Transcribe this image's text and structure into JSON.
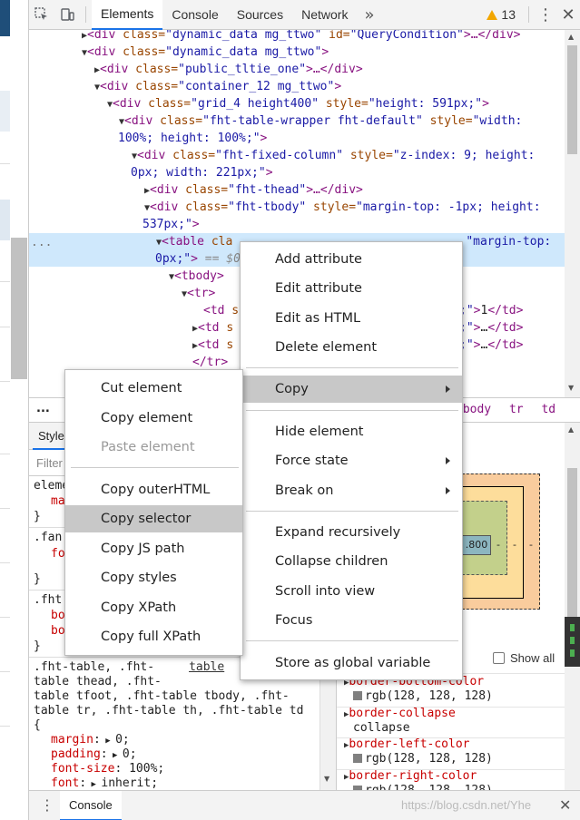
{
  "toolbar": {
    "tabs": [
      "Elements",
      "Console",
      "Sources",
      "Network"
    ],
    "more": "»",
    "warning_count": "13"
  },
  "tree": {
    "rows": [
      {
        "pre": "▶<",
        "tag": "div",
        "a1": " class=",
        "v1": "\"dynamic_data mg_ttwo\"",
        "a2": " id=",
        "v2": "\"QueryCondition\"",
        "post": ">…</div>"
      },
      {
        "pre": "▼<",
        "tag": "div",
        "a1": " class=",
        "v1": "\"dynamic_data mg_ttwo\"",
        "post": ">"
      },
      {
        "pre": "▶<",
        "tag": "div",
        "a1": " class=",
        "v1": "\"public_tltie_one\"",
        "post": ">…</div>"
      },
      {
        "pre": "▼<",
        "tag": "div",
        "a1": " class=",
        "v1": "\"container_12 mg_ttwo\"",
        "post": ">"
      },
      {
        "pre": "▼<",
        "tag": "div",
        "a1": " class=",
        "v1": "\"grid_4 height400\"",
        "a2": " style=",
        "v2": "\"height: 591px;\"",
        "post": ">"
      },
      {
        "pre": "▼<",
        "tag": "div",
        "a1": " class=",
        "v1": "\"fht-table-wrapper fht-default\"",
        "a2": " style=",
        "v2": "\"width:",
        "post": ""
      },
      {
        "pre": "",
        "tag": "",
        "v1": "100%; height: 100%;\"",
        "post": ">"
      },
      {
        "pre": "▼<",
        "tag": "div",
        "a1": " class=",
        "v1": "\"fht-fixed-column\"",
        "a2": " style=",
        "v2": "\"z-index: 9; height:",
        "post": ""
      },
      {
        "pre": "",
        "tag": "",
        "v1": "0px; width: 221px;\"",
        "post": ">"
      },
      {
        "pre": "▶<",
        "tag": "div",
        "a1": " class=",
        "v1": "\"fht-thead\"",
        "post": ">…</div>"
      },
      {
        "pre": "▼<",
        "tag": "div",
        "a1": " class=",
        "v1": "\"fht-tbody\"",
        "a2": " style=",
        "v2": "\"margin-top: -1px; height:",
        "post": ""
      },
      {
        "pre": "",
        "tag": "",
        "v1": "537px;\"",
        "post": ">"
      },
      {
        "pre": "▼<",
        "tag": "table",
        "a1": " cla",
        "v1": "",
        "a2": "",
        "v2": "\"margin-top:",
        "post": ""
      },
      {
        "pre": "",
        "tag": "",
        "v1": "0px;\"",
        "post": ">",
        "extra": " == $0"
      },
      {
        "pre": "▼<",
        "tag": "tbody",
        "post": ">"
      },
      {
        "pre": "▼<",
        "tag": "tr",
        "post": ">"
      },
      {
        "pre": "<",
        "tag": "td",
        "a1": " s",
        "post": "",
        "tail": ";\">1</td>"
      },
      {
        "pre": "▶<",
        "tag": "td",
        "a1": " s",
        "post": "",
        "tail": ";\">…</td>"
      },
      {
        "pre": "▶<",
        "tag": "td",
        "a1": " s",
        "post": "",
        "tail": ";\">…</td>"
      },
      {
        "pre": "</",
        "tag": "tr",
        "post": ">"
      }
    ],
    "gutter_dots": "..."
  },
  "crumbs": {
    "dots": "...",
    "items": [
      "tbody",
      "tr",
      "td"
    ]
  },
  "styles": {
    "tab": "Styles",
    "filter_placeholder": "Filter",
    "lines": {
      "l1": "eleme",
      "l2": "ma",
      "l3": "}",
      "l4": ".fan",
      "l5": "fo",
      "l6": "}",
      "l7": ".fht",
      "l8": "bo",
      "l9": "bo",
      "l10": "}",
      "r1a": ".fht-table, .fht-",
      "r1link": "table",
      "r2": "table thead, .fht-",
      "r3": "table tfoot, .fht-table tbody, .fht-",
      "r4": "table tr, .fht-table th, .fht-table td",
      "r5": "{",
      "p1": "margin",
      "p1v": "0;",
      "p2": "padding",
      "p2v": "0;",
      "p3": "font-size",
      "p3v": "100%;",
      "p4": "font",
      "p4v": "inherit;"
    }
  },
  "computed": {
    "content_width": ".800",
    "dash": "-",
    "show_all": "Show all",
    "props": [
      {
        "name": "border-bottom-color",
        "value": "rgb(128, 128, 128)",
        "swatch": true
      },
      {
        "name": "border-collapse",
        "value": "collapse",
        "swatch": false
      },
      {
        "name": "border-left-color",
        "value": "rgb(128, 128, 128)",
        "swatch": true
      },
      {
        "name": "border-right-color",
        "value": "rgb(128, 128, 128)",
        "swatch": true
      }
    ]
  },
  "drawer": {
    "tab": "Console",
    "watermark": "https://blog.csdn.net/Yhe"
  },
  "context_menu": {
    "items": [
      "Add attribute",
      "Edit attribute",
      "Edit as HTML",
      "Delete element",
      "Copy",
      "Hide element",
      "Force state",
      "Break on",
      "Expand recursively",
      "Collapse children",
      "Scroll into view",
      "Focus",
      "Store as global variable"
    ]
  },
  "copy_submenu": {
    "items": [
      "Cut element",
      "Copy element",
      "Paste element",
      "Copy outerHTML",
      "Copy selector",
      "Copy JS path",
      "Copy styles",
      "Copy XPath",
      "Copy full XPath"
    ]
  },
  "colors": {
    "selected_row": "#cfe8fc",
    "menu_highlight": "#c8c8c8",
    "tag": "#881280",
    "attr": "#994500",
    "value": "#1a1aa6"
  }
}
